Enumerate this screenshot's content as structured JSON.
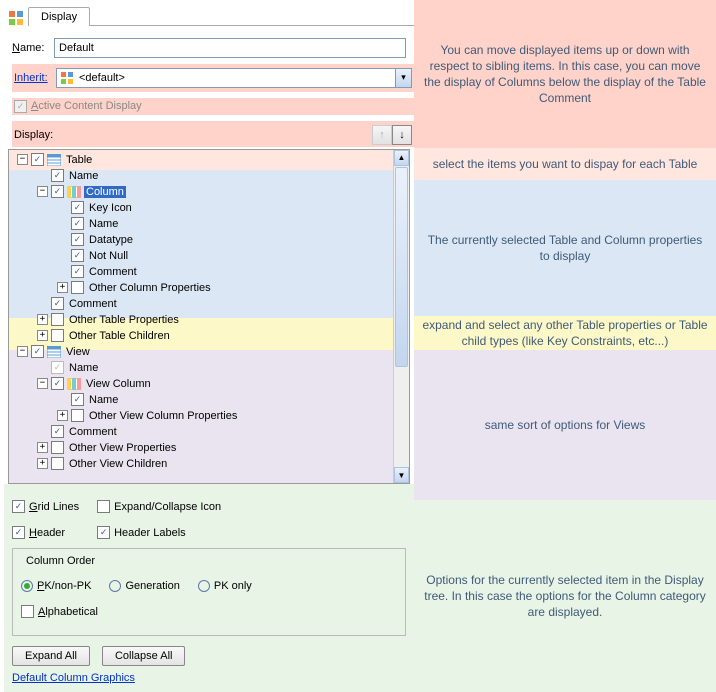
{
  "tab": {
    "label": "Display"
  },
  "form": {
    "nameLabel": "Name:",
    "nameValue": "Default",
    "inheritLabel": "Inherit:",
    "inheritValue": "<default>",
    "activeContent": "Active Content Display",
    "displayLabel": "Display:"
  },
  "tree": [
    {
      "d": 0,
      "exp": "-",
      "chk": "c",
      "icon": "table",
      "t": "Table"
    },
    {
      "d": 1,
      "exp": "",
      "chk": "c",
      "icon": "",
      "t": "Name"
    },
    {
      "d": 1,
      "exp": "-",
      "chk": "c",
      "icon": "col",
      "t": "Column",
      "sel": true
    },
    {
      "d": 2,
      "exp": "",
      "chk": "c",
      "icon": "",
      "t": "Key Icon"
    },
    {
      "d": 2,
      "exp": "",
      "chk": "c",
      "icon": "",
      "t": "Name"
    },
    {
      "d": 2,
      "exp": "",
      "chk": "c",
      "icon": "",
      "t": "Datatype"
    },
    {
      "d": 2,
      "exp": "",
      "chk": "c",
      "icon": "",
      "t": "Not Null"
    },
    {
      "d": 2,
      "exp": "",
      "chk": "c",
      "icon": "",
      "t": "Comment"
    },
    {
      "d": 2,
      "exp": "+",
      "chk": "",
      "icon": "",
      "t": "Other Column Properties"
    },
    {
      "d": 1,
      "exp": "",
      "chk": "c",
      "icon": "",
      "t": "Comment"
    },
    {
      "d": 1,
      "exp": "+",
      "chk": "",
      "icon": "",
      "t": "Other Table Properties"
    },
    {
      "d": 1,
      "exp": "+",
      "chk": "",
      "icon": "",
      "t": "Other Table Children"
    },
    {
      "d": 0,
      "exp": "-",
      "chk": "c",
      "icon": "table",
      "t": "View"
    },
    {
      "d": 1,
      "exp": "",
      "chk": "cg",
      "icon": "",
      "t": "Name"
    },
    {
      "d": 1,
      "exp": "-",
      "chk": "c",
      "icon": "col",
      "t": "View Column"
    },
    {
      "d": 2,
      "exp": "",
      "chk": "c",
      "icon": "",
      "t": "Name"
    },
    {
      "d": 2,
      "exp": "+",
      "chk": "",
      "icon": "",
      "t": "Other View Column Properties"
    },
    {
      "d": 1,
      "exp": "",
      "chk": "c",
      "icon": "",
      "t": "Comment"
    },
    {
      "d": 1,
      "exp": "+",
      "chk": "",
      "icon": "",
      "t": "Other View Properties"
    },
    {
      "d": 1,
      "exp": "+",
      "chk": "",
      "icon": "",
      "t": "Other View Children"
    }
  ],
  "opts": {
    "gridLines": "Grid Lines",
    "expandCollapse": "Expand/Collapse Icon",
    "header": "Header",
    "headerLabels": "Header Labels",
    "columnOrder": "Column Order",
    "pkNonPk": "PK/non-PK",
    "generation": "Generation",
    "pkOnly": "PK only",
    "alphabetical": "Alphabetical",
    "expandAll": "Expand All",
    "collapseAll": "Collapse All",
    "defaultGraphics": "Default Column Graphics"
  },
  "annot": {
    "a1": "You can move displayed items up or down with respect to sibling items.  In this case, you can move the display of Columns below the display of the Table Comment",
    "a2": "select the items you want to dispay for each Table",
    "a3": "The currently selected Table and Column properties to display",
    "a4": "expand and select any other Table properties or Table child types (like Key Constraints, etc...)",
    "a5": "same sort of options for Views",
    "a6": "Options for the currently selected item in the Display tree.  In this case the options for the Column category are displayed."
  }
}
